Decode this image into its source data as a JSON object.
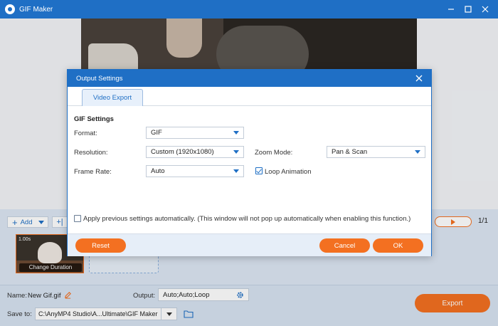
{
  "app": {
    "title": "GIF Maker"
  },
  "timeline": {
    "add_label": "Add",
    "add2_label": "+|",
    "page_count": "1/1",
    "clip": {
      "duration": "1.00s",
      "change_duration_label": "Change Duration"
    }
  },
  "bottom": {
    "name_label": "Name:",
    "name_value": "New Gif.gif",
    "output_label": "Output:",
    "output_value": "Auto;Auto;Loop",
    "saveto_label": "Save to:",
    "saveto_value": "C:\\AnyMP4 Studio\\A...Ultimate\\GIF Maker",
    "export_label": "Export"
  },
  "dialog": {
    "title": "Output Settings",
    "tab_label": "Video Export",
    "section_title": "GIF Settings",
    "format": {
      "label": "Format:",
      "value": "GIF"
    },
    "resolution": {
      "label": "Resolution:",
      "value": "Custom (1920x1080)"
    },
    "zoom_mode": {
      "label": "Zoom Mode:",
      "value": "Pan & Scan"
    },
    "frame_rate": {
      "label": "Frame Rate:",
      "value": "Auto"
    },
    "loop_animation": {
      "label": "Loop Animation",
      "checked": true
    },
    "apply_previous": {
      "label": "Apply previous settings automatically. (This window will not pop up automatically when enabling this function.)",
      "checked": false
    },
    "reset_label": "Reset",
    "cancel_label": "Cancel",
    "ok_label": "OK"
  },
  "colors": {
    "accent_blue": "#1f6fc5",
    "accent_orange": "#f37021"
  }
}
